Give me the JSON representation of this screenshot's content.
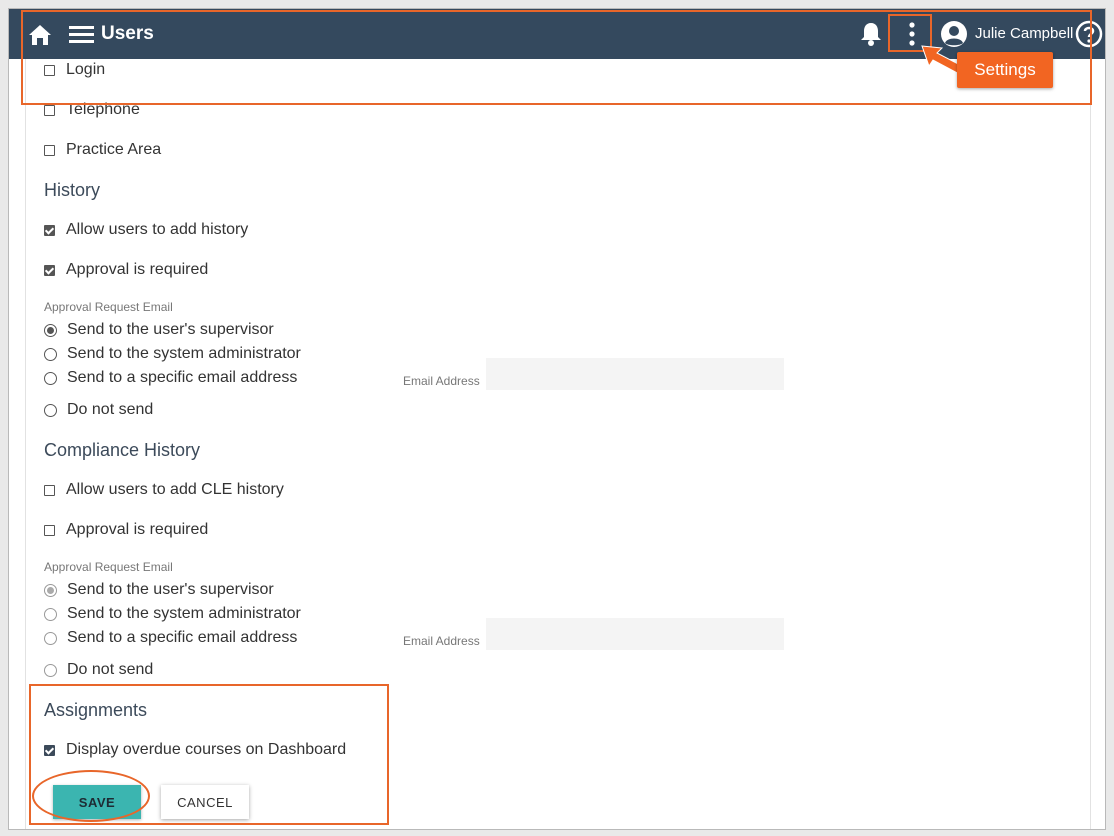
{
  "header": {
    "title": "Users",
    "user_name": "Julie Campbell",
    "icons": [
      "home-icon",
      "menu-icon",
      "bell-icon",
      "kebab-icon",
      "avatar-icon",
      "help-icon"
    ]
  },
  "fields": {
    "login": "Login",
    "telephone": "Telephone",
    "practice_area": "Practice Area"
  },
  "history": {
    "title": "History",
    "allow_add": "Allow users to add history",
    "approval_required": "Approval is required",
    "email_label": "Approval Request Email",
    "options": [
      "Send to the user's supervisor",
      "Send to the system administrator",
      "Send to a specific email address",
      "Do not send"
    ],
    "email_address_label": "Email Address",
    "email_value": ""
  },
  "compliance": {
    "title": "Compliance History",
    "allow_add": "Allow users to add CLE history",
    "approval_required": "Approval is required",
    "email_label": "Approval Request Email",
    "options": [
      "Send to the user's supervisor",
      "Send to the system administrator",
      "Send to a specific email address",
      "Do not send"
    ],
    "email_address_label": "Email Address",
    "email_value": ""
  },
  "assignments": {
    "title": "Assignments",
    "display_overdue": "Display overdue courses on Dashboard"
  },
  "actions": {
    "save": "SAVE",
    "cancel": "CANCEL"
  },
  "callout": {
    "settings": "Settings"
  },
  "colors": {
    "header_bg": "#34495e",
    "accent_teal": "#3bb5b0",
    "callout_orange": "#f26522"
  }
}
